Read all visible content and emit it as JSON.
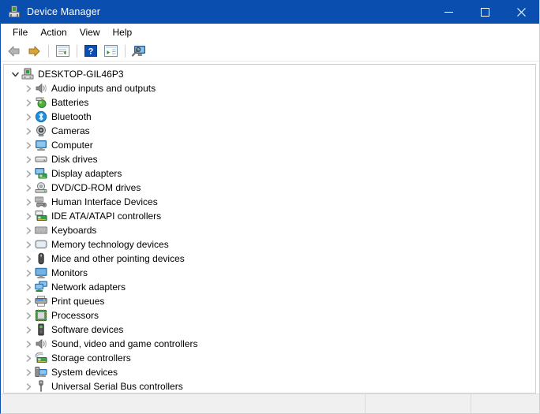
{
  "window": {
    "title": "Device Manager",
    "title_icon": "device-manager-icon",
    "titlebar_color": "#0a4fb0",
    "controls": [
      {
        "name": "minimize-button",
        "glyph": "minimize"
      },
      {
        "name": "maximize-button",
        "glyph": "maximize"
      },
      {
        "name": "close-button",
        "glyph": "close"
      }
    ]
  },
  "menubar": {
    "items": [
      {
        "label": "File"
      },
      {
        "label": "Action"
      },
      {
        "label": "View"
      },
      {
        "label": "Help"
      }
    ]
  },
  "toolbar": {
    "buttons": [
      {
        "name": "back-button",
        "icon": "back-arrow-icon"
      },
      {
        "name": "forward-button",
        "icon": "forward-arrow-icon"
      },
      {
        "name": "separator-1",
        "icon": "separator"
      },
      {
        "name": "show-hide-console-tree-button",
        "icon": "console-tree-icon"
      },
      {
        "name": "separator-2",
        "icon": "separator"
      },
      {
        "name": "help-button",
        "icon": "help-question-icon"
      },
      {
        "name": "properties-button",
        "icon": "properties-list-icon"
      },
      {
        "name": "separator-3",
        "icon": "separator"
      },
      {
        "name": "scan-for-hardware-changes-button",
        "icon": "scan-hardware-icon"
      }
    ]
  },
  "tree": {
    "root": {
      "label": "DESKTOP-GIL46P3",
      "icon": "computer-node-icon",
      "expanded": true
    },
    "nodes": [
      {
        "label": "Audio inputs and outputs",
        "icon": "speaker-icon",
        "expanded": false
      },
      {
        "label": "Batteries",
        "icon": "battery-icon",
        "expanded": false
      },
      {
        "label": "Bluetooth",
        "icon": "bluetooth-icon",
        "expanded": false
      },
      {
        "label": "Cameras",
        "icon": "camera-icon",
        "expanded": false
      },
      {
        "label": "Computer",
        "icon": "monitor-icon",
        "expanded": false
      },
      {
        "label": "Disk drives",
        "icon": "disk-drive-icon",
        "expanded": false
      },
      {
        "label": "Display adapters",
        "icon": "display-adapter-icon",
        "expanded": false
      },
      {
        "label": "DVD/CD-ROM drives",
        "icon": "optical-drive-icon",
        "expanded": false
      },
      {
        "label": "Human Interface Devices",
        "icon": "hid-gamepad-icon",
        "expanded": false
      },
      {
        "label": "IDE ATA/ATAPI controllers",
        "icon": "ide-controller-icon",
        "expanded": false
      },
      {
        "label": "Keyboards",
        "icon": "keyboard-icon",
        "expanded": false
      },
      {
        "label": "Memory technology devices",
        "icon": "memory-device-icon",
        "expanded": false
      },
      {
        "label": "Mice and other pointing devices",
        "icon": "mouse-icon",
        "expanded": false
      },
      {
        "label": "Monitors",
        "icon": "monitor-screen-icon",
        "expanded": false
      },
      {
        "label": "Network adapters",
        "icon": "network-adapter-icon",
        "expanded": false
      },
      {
        "label": "Print queues",
        "icon": "printer-icon",
        "expanded": false
      },
      {
        "label": "Processors",
        "icon": "processor-chip-icon",
        "expanded": false
      },
      {
        "label": "Software devices",
        "icon": "software-device-icon",
        "expanded": false
      },
      {
        "label": "Sound, video and game controllers",
        "icon": "sound-speaker-icon",
        "expanded": false
      },
      {
        "label": "Storage controllers",
        "icon": "storage-controller-icon",
        "expanded": false
      },
      {
        "label": "System devices",
        "icon": "system-device-icon",
        "expanded": false
      },
      {
        "label": "Universal Serial Bus controllers",
        "icon": "usb-controller-icon",
        "expanded": false
      }
    ]
  },
  "statusbar": {
    "panels": [
      {
        "text": ""
      },
      {
        "text": ""
      },
      {
        "text": ""
      }
    ]
  }
}
